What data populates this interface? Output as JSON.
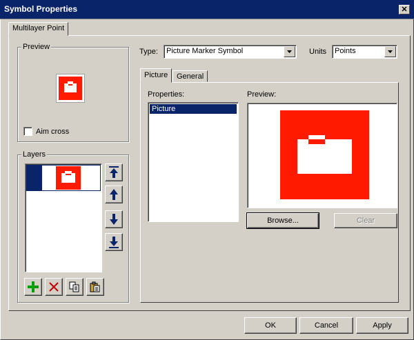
{
  "window": {
    "title": "Symbol Properties"
  },
  "outer_tab": {
    "label": "Multilayer Point"
  },
  "preview_group": {
    "label": "Preview",
    "aim_cross_label": "Aim cross"
  },
  "layers_group": {
    "label": "Layers"
  },
  "type_field": {
    "label": "Type:",
    "value": "Picture Marker Symbol"
  },
  "units_field": {
    "label": "Units",
    "value": "Points"
  },
  "inner_tabs": [
    {
      "label": "Picture"
    },
    {
      "label": "General"
    }
  ],
  "properties": {
    "label": "Properties:",
    "items": [
      {
        "label": "Picture"
      }
    ]
  },
  "right_preview": {
    "label": "Preview:"
  },
  "buttons": {
    "browse": "Browse...",
    "clear": "Clear",
    "ok": "OK",
    "cancel": "Cancel",
    "apply": "Apply"
  },
  "colors": {
    "symbol_red": "#ff1a00",
    "selection": "#0a246a",
    "face": "#d4d0c8"
  },
  "icons": [
    "briefcase-icon",
    "close-icon",
    "move-top-icon",
    "move-up-icon",
    "move-down-icon",
    "move-bottom-icon",
    "add-icon",
    "delete-icon",
    "copy-icon",
    "paste-icon"
  ]
}
